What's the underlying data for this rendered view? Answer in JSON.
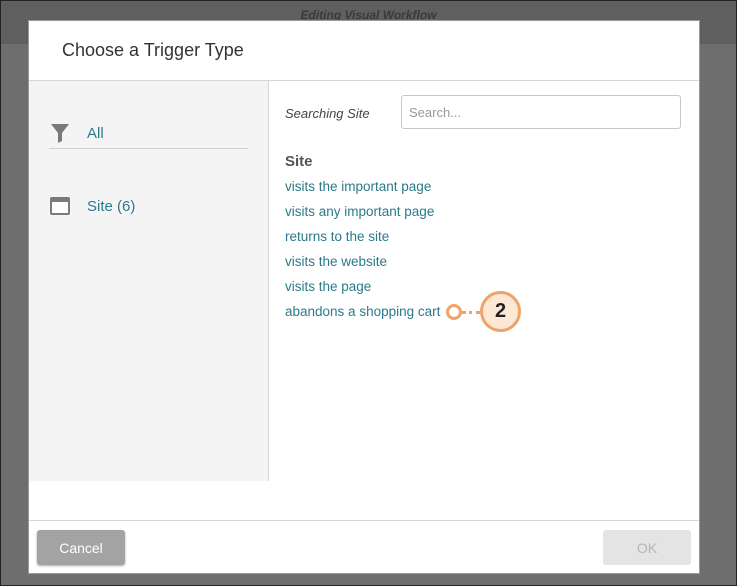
{
  "backdrop": {
    "title": "Editing Visual Workflow"
  },
  "dialog": {
    "title": "Choose a Trigger Type",
    "sidebar": {
      "items": [
        {
          "label": "All",
          "icon": "filter-icon"
        },
        {
          "label": "Site (6)",
          "icon": "window-icon"
        }
      ]
    },
    "search": {
      "label": "Searching Site",
      "placeholder": "Search...",
      "value": ""
    },
    "group_title": "Site",
    "triggers": [
      "visits the important page",
      "visits any important page",
      "returns to the site",
      "visits the website",
      "visits the page",
      "abandons a shopping cart"
    ],
    "footer": {
      "cancel_label": "Cancel",
      "ok_label": "OK"
    }
  },
  "callout": {
    "number": "2",
    "color": "#f0a368"
  },
  "colors": {
    "link": "#2b7a8a",
    "backdrop": "#6e6e6e"
  }
}
